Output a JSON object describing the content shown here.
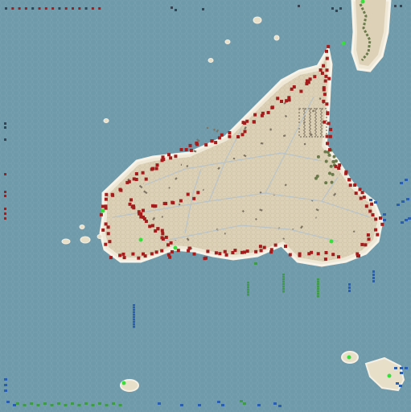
{
  "map": {
    "title": "",
    "colors": {
      "sea": "#6f9aaa",
      "sea_hex": "#7aa3b2",
      "land": "#ddd2b8",
      "land_hex": "#cbbfa2",
      "coast": "#f2ede0",
      "road": "#8a7f6a",
      "hill": "#7e7464",
      "forest": "#6a7a4a",
      "red_unit": "#a51c1c",
      "blue_unit": "#2a5fb0",
      "green_unit": "#3f9a4a",
      "dark_unit": "#334455",
      "selected": "#36e03a"
    },
    "factions": [
      {
        "name": "red",
        "count_shown": 310
      },
      {
        "name": "blue",
        "count_shown": 40
      },
      {
        "name": "green",
        "count_shown": 32
      }
    ]
  }
}
